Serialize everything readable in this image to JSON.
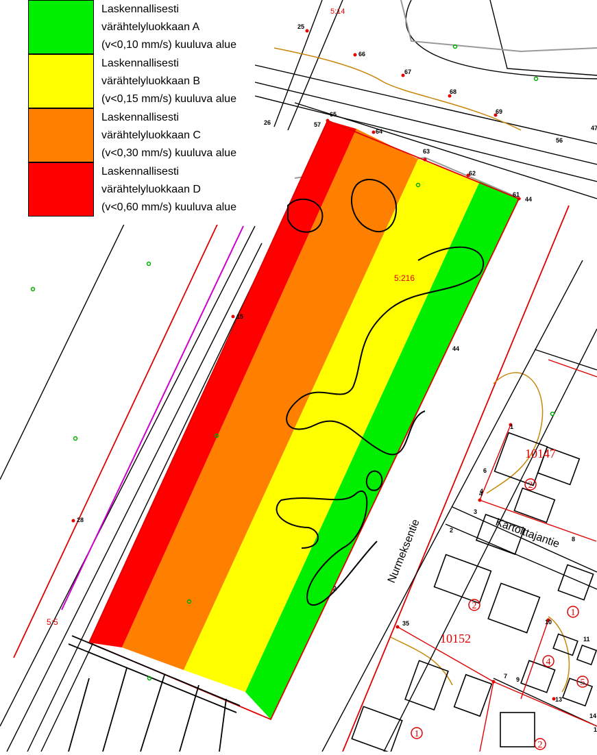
{
  "legend": {
    "items": [
      {
        "lines": [
          "Laskennallisesti",
          "värähtelyluokkaan A",
          "(v<0,10 mm/s) kuuluva alue"
        ],
        "color": "#00ee00"
      },
      {
        "lines": [
          "Laskennallisesti",
          "värähtelyluokkaan B",
          "(v<0,15 mm/s) kuuluva alue"
        ],
        "color": "#ffff00"
      },
      {
        "lines": [
          "Laskennallisesti",
          "värähtelyluokkaan C",
          "(v<0,30 mm/s) kuuluva alue"
        ],
        "color": "#ff8000"
      },
      {
        "lines": [
          "Laskennallisesti",
          "värähtelyluokkaan D",
          "(v<0,60 mm/s) kuuluva alue"
        ],
        "color": "#ff0000"
      }
    ]
  },
  "map": {
    "streets": {
      "nurmeksentie": "Nurmeksentie",
      "kartoittajantie": "Kartoittajantie"
    },
    "blocks": {
      "block_10147": "10147",
      "block_10152": "10152"
    },
    "plot_numbers": [
      "2",
      "2",
      "1",
      "4",
      "5",
      "1",
      "2"
    ],
    "elevation_label": "5:216",
    "point_labels": [
      "25",
      "66",
      "67",
      "68",
      "69",
      "65",
      "64",
      "63",
      "62",
      "61",
      "44",
      "15",
      "28",
      "35",
      "14",
      "10",
      "11",
      "9",
      "13",
      "12",
      "8",
      "6",
      "4",
      "3",
      "2",
      "1",
      "26",
      "57",
      "56",
      "47",
      "44",
      "2",
      "7",
      "4"
    ],
    "lot_label_top": "5:14",
    "lot_label_left": "5:5",
    "colors": {
      "zone_a": "#00ee00",
      "zone_b": "#ffff00",
      "zone_c": "#ff8000",
      "zone_d": "#ff0000",
      "boundary": "#e00000",
      "contour": "#000000",
      "brown_line": "#c8860a",
      "grey_line": "#999999",
      "symbol_green": "#00aa00",
      "magenta": "#cc00cc"
    }
  }
}
